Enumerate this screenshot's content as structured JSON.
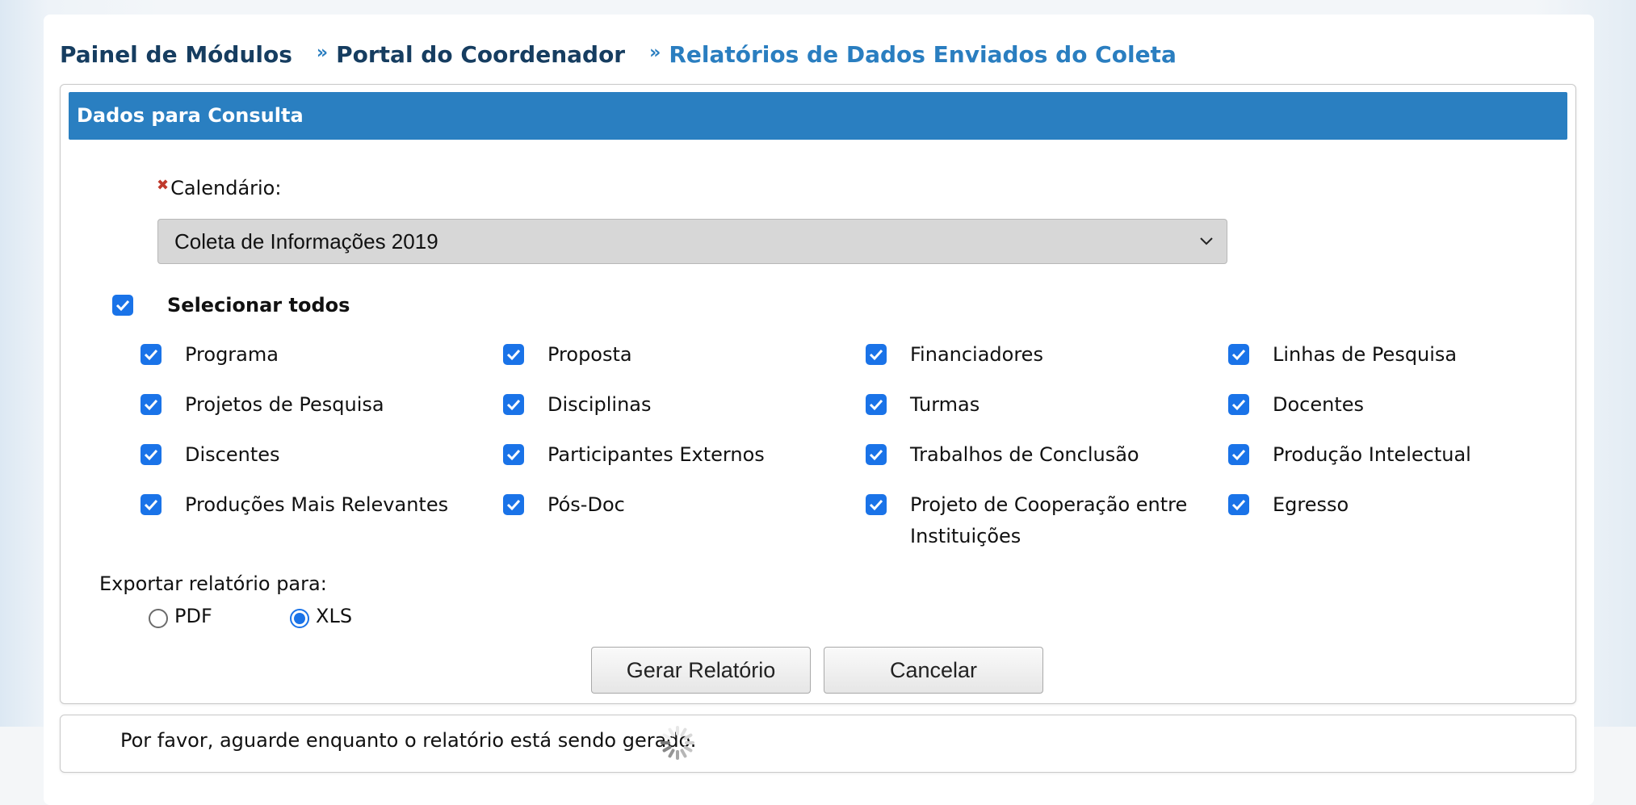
{
  "breadcrumb": {
    "items": [
      "Painel de Módulos",
      "Portal do Coordenador",
      "Relatórios de Dados Enviados do Coleta"
    ],
    "separator": "»"
  },
  "panel": {
    "title": "Dados para Consulta",
    "required_mark": "✖",
    "calendar_label": "Calendário:",
    "calendar_value": "Coleta de Informações 2019",
    "select_all_label": "Selecionar todos",
    "options": {
      "programa": "Programa",
      "proposta": "Proposta",
      "financiadores": "Financiadores",
      "linhas_pesquisa": "Linhas de Pesquisa",
      "projetos_pesquisa": "Projetos de Pesquisa",
      "disciplinas": "Disciplinas",
      "turmas": "Turmas",
      "docentes": "Docentes",
      "discentes": "Discentes",
      "participantes_externos": "Participantes Externos",
      "trabalhos_conclusao": "Trabalhos de Conclusão",
      "producao_intelectual": "Produção Intelectual",
      "producoes_relevantes": "Produções Mais Relevantes",
      "pos_doc": "Pós-Doc",
      "projeto_cooperacao_l1": "Projeto de Cooperação entre",
      "projeto_cooperacao_l2": "Instituições",
      "egresso": "Egresso"
    },
    "export_label": "Exportar relatório para:",
    "export_options": {
      "pdf": "PDF",
      "xls": "XLS"
    },
    "export_selected": "XLS",
    "generate_button": "Gerar Relatório",
    "cancel_button": "Cancelar"
  },
  "status": {
    "message": "Por favor, aguarde enquanto o relatório está sendo gerado."
  },
  "colors": {
    "header_blue": "#2a7fc1",
    "breadcrumb_dark": "#163d60",
    "breadcrumb_active": "#2a7ec0",
    "checkbox_blue": "#1a73e8"
  }
}
